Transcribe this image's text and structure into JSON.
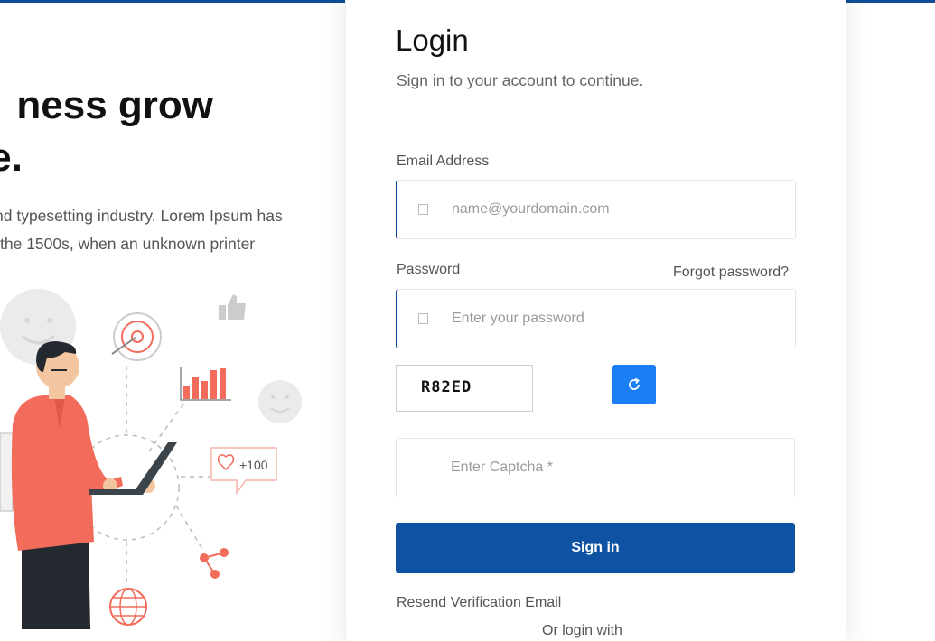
{
  "hero": {
    "title_line1": "ness grow",
    "title_line2": "e.",
    "text_line1": "nd typesetting industry. Lorem Ipsum has",
    "text_line2": " the 1500s, when an unknown printer",
    "badge_count": "+100"
  },
  "login": {
    "title": "Login",
    "subtitle": "Sign in to your account to continue.",
    "email_label": "Email Address",
    "email_placeholder": "name@yourdomain.com",
    "password_label": "Password",
    "forgot_link": "Forgot password?",
    "password_placeholder": "Enter your password",
    "captcha_code": "R82ED",
    "captcha_placeholder": "Enter Captcha *",
    "signin_label": "Sign in",
    "resend_link": "Resend Verification Email",
    "or_sign_in_with": "Or login with"
  },
  "colors": {
    "brand_primary": "#0f52a3",
    "refresh_button": "#1a7ef5",
    "accent_illustration": "#f26b5b"
  },
  "icons": {
    "email_field": "envelope-icon",
    "password_field": "lock-icon",
    "captcha_refresh": "refresh-icon"
  }
}
